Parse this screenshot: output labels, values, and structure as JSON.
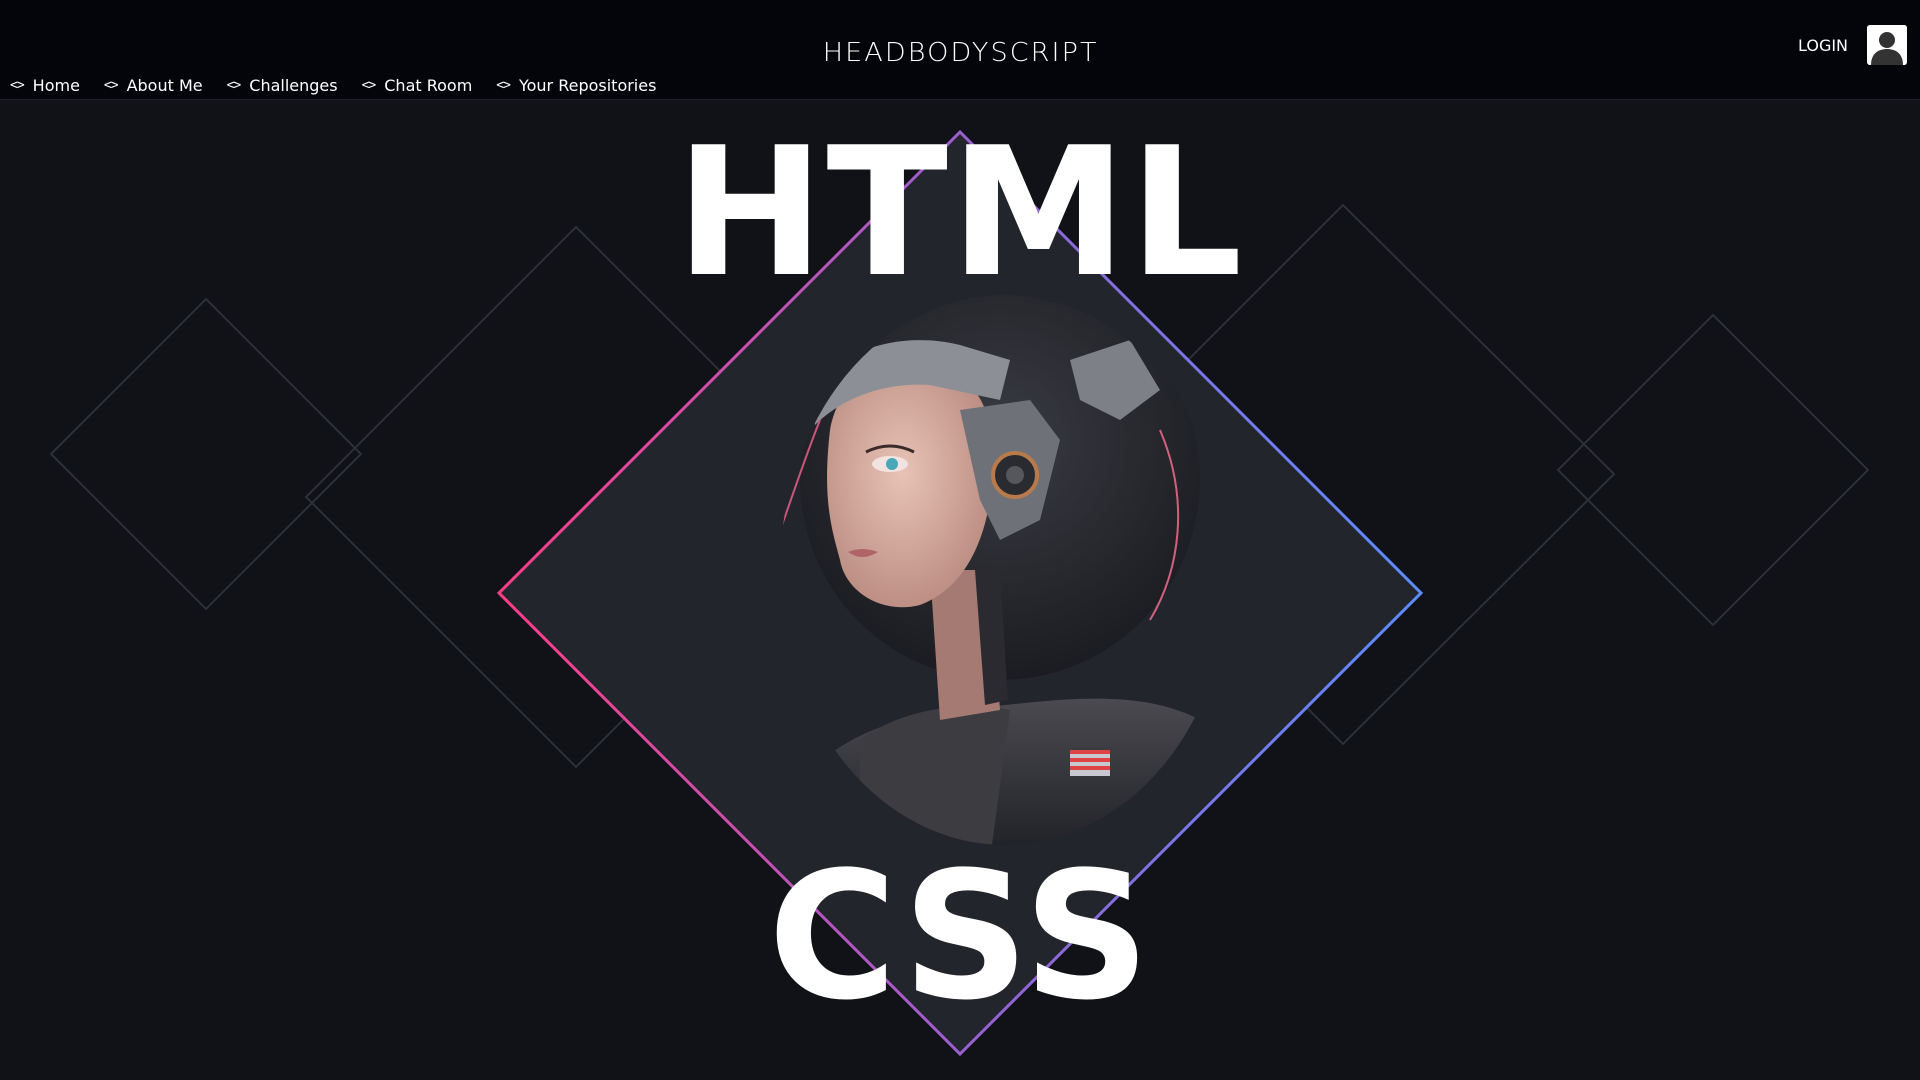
{
  "header": {
    "logo": "HEADBODYSCRIPT",
    "login_label": "LOGIN",
    "nav": [
      {
        "icon": "code-icon",
        "label": "Home"
      },
      {
        "icon": "code-icon",
        "label": "About Me"
      },
      {
        "icon": "code-icon",
        "label": "Challenges"
      },
      {
        "icon": "code-icon",
        "label": "Chat Room"
      },
      {
        "icon": "code-icon",
        "label": "Your Repositories"
      }
    ]
  },
  "hero": {
    "title": "HTML",
    "subtitle": "CSS",
    "image": "cyberpunk-girl-illustration",
    "gradient": [
      "#ff3d8a",
      "#5b8cff"
    ]
  },
  "colors": {
    "header_bg": "#03050a",
    "page_bg": "#101217",
    "diamond_fill": "#22252b",
    "outline": "#2e3138"
  }
}
